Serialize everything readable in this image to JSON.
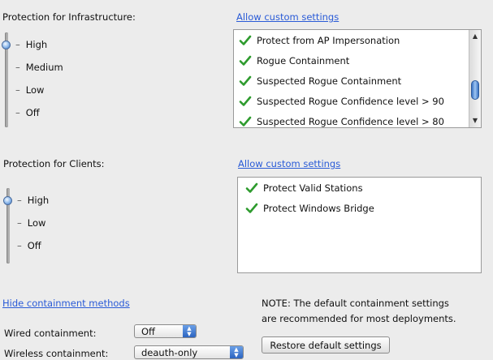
{
  "infrastructure": {
    "title": "Protection for Infrastructure:",
    "custom_link": "Allow custom settings",
    "levels": [
      "High",
      "Medium",
      "Low",
      "Off"
    ],
    "selected_level": "High",
    "items": [
      {
        "label": "Protect from AP Impersonation",
        "checked": true
      },
      {
        "label": "Rogue Containment",
        "checked": true
      },
      {
        "label": "Suspected Rogue Containment",
        "checked": true
      },
      {
        "label": "Suspected Rogue Confidence level > 90",
        "checked": true
      },
      {
        "label": "Suspected Rogue Confidence level > 80",
        "checked": true
      }
    ]
  },
  "clients": {
    "title": "Protection for Clients:",
    "custom_link": "Allow custom settings",
    "levels": [
      "High",
      "Low",
      "Off"
    ],
    "selected_level": "High",
    "items": [
      {
        "label": "Protect Valid Stations",
        "checked": true
      },
      {
        "label": "Protect Windows Bridge",
        "checked": true
      }
    ]
  },
  "containment": {
    "toggle_link": "Hide containment methods",
    "wired_label": "Wired containment:",
    "wired_value": "Off",
    "wireless_label": "Wireless containment:",
    "wireless_value": "deauth-only"
  },
  "note": {
    "line1": "NOTE: The default containment settings",
    "line2": "are recommended for most deployments."
  },
  "restore_button": "Restore default settings",
  "colors": {
    "link": "#2a5bd7",
    "check": "#2e9b2e",
    "slider_knob": "#3c78c8"
  }
}
